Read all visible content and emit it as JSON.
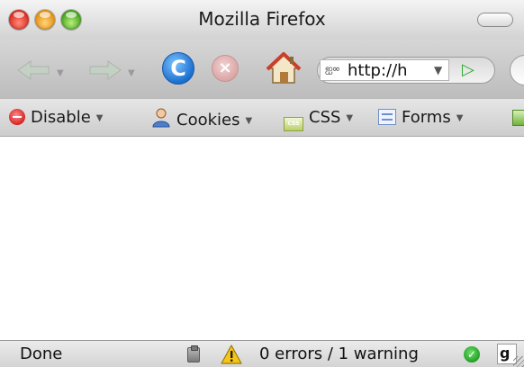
{
  "window": {
    "title": "Mozilla Firefox"
  },
  "navigation": {
    "back_icon": "back-arrow-icon",
    "forward_icon": "forward-arrow-icon",
    "reload_icon": "reload-icon",
    "reload_glyph": "C",
    "stop_icon": "stop-icon",
    "stop_glyph": "×",
    "home_icon": "home-icon",
    "url_value": "http://h",
    "site_icon_glyph": "ஐ∞",
    "go_icon": "go-arrow-icon",
    "go_glyph": "▷",
    "dropdown_glyph": "▼"
  },
  "dev_toolbar": {
    "items": [
      {
        "label": "Disable",
        "icon": "disable-icon"
      },
      {
        "label": "Cookies",
        "icon": "cookies-icon"
      },
      {
        "label": "CSS",
        "icon": "css-icon"
      },
      {
        "label": "Forms",
        "icon": "forms-icon"
      }
    ],
    "css_icon_text": "CSS",
    "dropdown_glyph": "▼"
  },
  "status_bar": {
    "status": "Done",
    "errors": "0 errors / 1 warning",
    "status_ok_glyph": "✓",
    "gp_text": "g"
  },
  "colors": {
    "reload_blue": "#1a6fd0",
    "stop_pink": "#d9a3a3",
    "go_green": "#2fa82f",
    "warning_yellow": "#f5c518",
    "ok_green": "#1f9a1f"
  }
}
